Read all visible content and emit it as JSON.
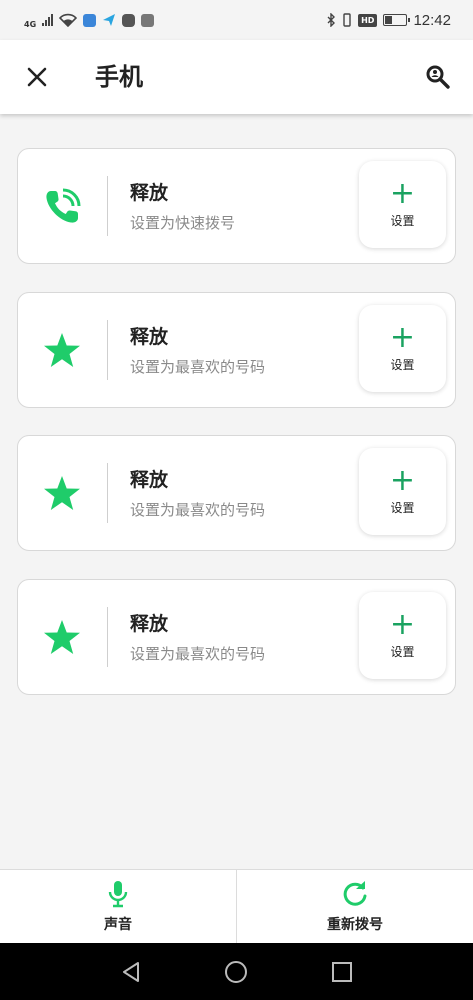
{
  "status_bar": {
    "network": "4G",
    "hd": "HD",
    "time": "12:42",
    "icons": [
      "signal-icon",
      "wifi-icon",
      "app-notification-icon",
      "send-icon",
      "camera-app-icon",
      "game-app-icon",
      "bluetooth-icon",
      "vibrate-icon",
      "battery-icon"
    ]
  },
  "header": {
    "title": "手机",
    "close_icon": "close-icon",
    "search_icon": "search-icon"
  },
  "cards": [
    {
      "icon": "phone-dialing-icon",
      "title": "释放",
      "subtitle": "设置为快速拨号",
      "button_plus": "+",
      "button_label": "设置"
    },
    {
      "icon": "star-icon",
      "title": "释放",
      "subtitle": "设置为最喜欢的号码",
      "button_plus": "+",
      "button_label": "设置"
    },
    {
      "icon": "star-icon",
      "title": "释放",
      "subtitle": "设置为最喜欢的号码",
      "button_plus": "+",
      "button_label": "设置"
    },
    {
      "icon": "star-icon",
      "title": "释放",
      "subtitle": "设置为最喜欢的号码",
      "button_plus": "+",
      "button_label": "设置"
    }
  ],
  "bottom_bar": {
    "voice_label": "声音",
    "redial_label": "重新拨号"
  },
  "colors": {
    "accent_green": "#1fcc6a",
    "plus_green": "#1aa260",
    "background": "#f4f4f4"
  }
}
